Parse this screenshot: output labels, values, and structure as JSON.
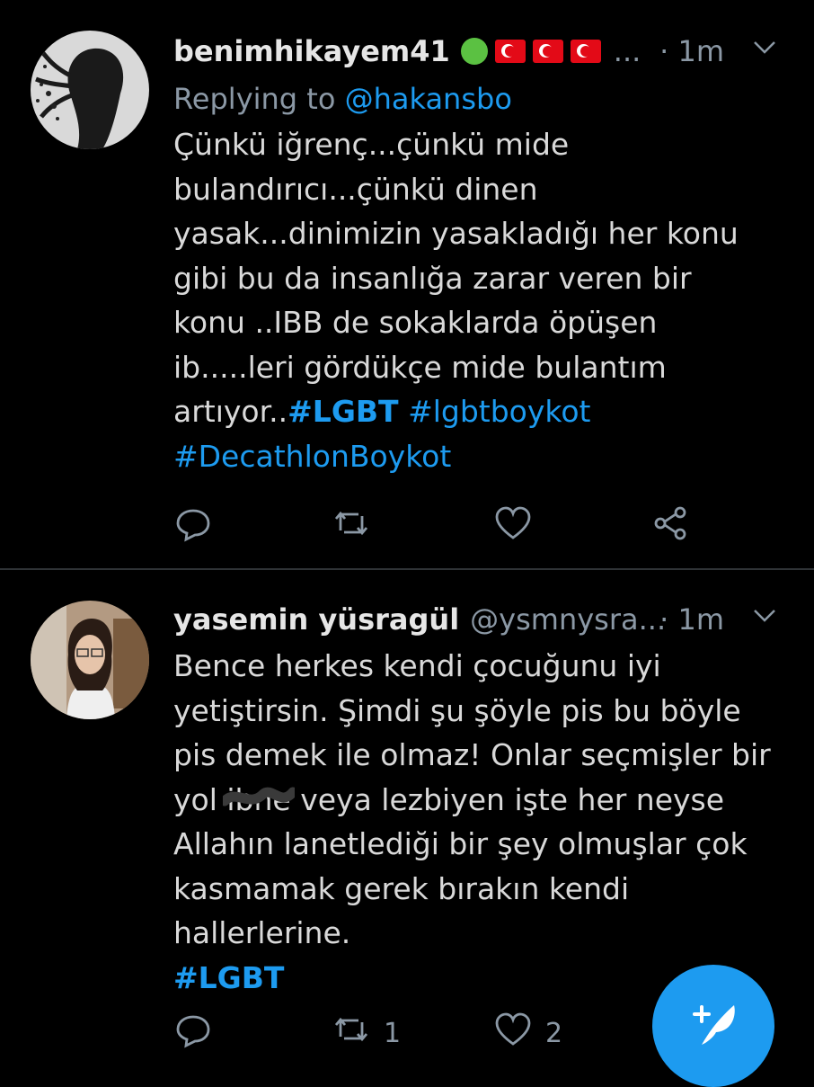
{
  "tweets": [
    {
      "display_name": "benimhikayem41",
      "badges": [
        "green-circle",
        "turkey-flag",
        "turkey-flag",
        "turkey-flag"
      ],
      "truncation": "...",
      "time": "· 1m",
      "replying_prefix": "Replying to",
      "replying_to": "@hakansbo",
      "lines": [
        "Çünkü iğrenç...çünkü mide",
        "bulandırıcı...çünkü dinen",
        "yasak...dinimizin yasakladığı her konu",
        "gibi bu da insanlığa zarar veren bir",
        "konu ..IBB de sokaklarda öpüşen",
        "ib.....leri gördükçe mide bulantım"
      ],
      "last_line_text": "artıyor..",
      "hashtags": [
        "#LGBT",
        "#lgbtboykot",
        "#DecathlonBoykot"
      ],
      "retweet_count": "",
      "like_count": ""
    },
    {
      "display_name": "yasemin yüsragül",
      "handle": "@ysmnysra...",
      "time": "· 1m",
      "lines": [
        "Bence herkes kendi çocuğunu iyi",
        "yetiştirsin. Şimdi şu şöyle pis bu böyle",
        "pis demek ile olmaz! Onlar seçmişler bir"
      ],
      "line4_start": "yol ",
      "line4_scribbled": "ibne",
      "line4_end": " veya lezbiyen işte her neyse",
      "lines_after": [
        "Allahın lanetlediği bir şey olmuşlar çok",
        "kasmamak gerek bırakın kendi",
        "hallerlerine."
      ],
      "hashtags": [
        "#LGBT"
      ],
      "retweet_count": "1",
      "like_count": "2"
    }
  ],
  "colors": {
    "background": "#000000",
    "text": "#d9d9d9",
    "secondary": "#8b98a5",
    "accent": "#1d9bf0"
  },
  "icons": [
    "reply-icon",
    "retweet-icon",
    "like-icon",
    "share-icon",
    "chevron-down-icon",
    "compose-icon"
  ]
}
